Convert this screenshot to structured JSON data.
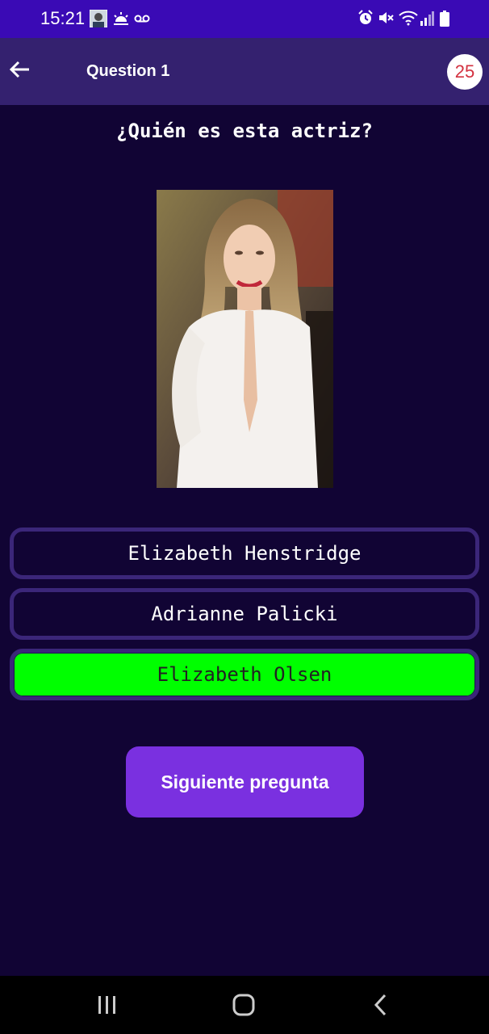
{
  "status_bar": {
    "time": "15:21",
    "left_icons": [
      "avatar-icon",
      "weather-icon",
      "voicemail-icon"
    ],
    "right_icons": [
      "alarm-icon",
      "mute-icon",
      "wifi-icon",
      "signal-icon",
      "battery-icon"
    ]
  },
  "app_bar": {
    "title": "Question 1",
    "timer": "25",
    "back_icon": "arrow-left-icon"
  },
  "question": {
    "text": "¿Quién es esta actriz?"
  },
  "answers": [
    {
      "label": "Elizabeth Henstridge",
      "state": "default"
    },
    {
      "label": "Adrianne Palicki",
      "state": "default"
    },
    {
      "label": "Elizabeth Olsen",
      "state": "correct"
    }
  ],
  "next_button": {
    "label": "Siguiente pregunta"
  },
  "colors": {
    "background": "#110434",
    "status_bar": "#3a0ab5",
    "app_bar": "#34216f",
    "answer_border": "#3b2679",
    "correct": "#00ff00",
    "button": "#7a30e0",
    "timer_text": "#d3313f"
  },
  "nav_bar": {
    "icons": [
      "recent-apps-icon",
      "home-icon",
      "back-icon"
    ]
  }
}
